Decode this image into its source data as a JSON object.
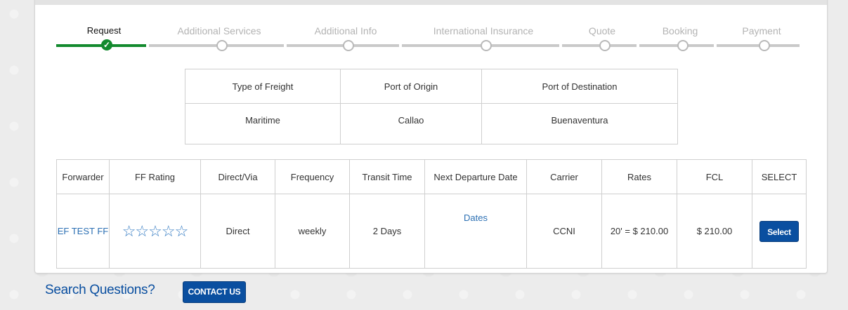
{
  "wizard": {
    "steps": [
      {
        "label": "Request",
        "state": "done"
      },
      {
        "label": "Additional Services",
        "state": "pending"
      },
      {
        "label": "Additional Info",
        "state": "pending"
      },
      {
        "label": "International Insurance",
        "state": "pending"
      },
      {
        "label": "Quote",
        "state": "pending"
      },
      {
        "label": "Booking",
        "state": "pending"
      },
      {
        "label": "Payment",
        "state": "pending"
      }
    ],
    "check_glyph": "✓"
  },
  "summary": {
    "headers": [
      "Type of Freight",
      "Port of Origin",
      "Port of Destination"
    ],
    "values": [
      "Maritime",
      "Callao",
      "Buenaventura"
    ]
  },
  "results": {
    "headers": [
      "Forwarder",
      "FF Rating",
      "Direct/Via",
      "Frequency",
      "Transit Time",
      "Next Departure Date",
      "Carrier",
      "Rates",
      "FCL",
      "SELECT"
    ],
    "row": {
      "forwarder": "EF TEST FF",
      "rating_stars": "☆☆☆☆☆",
      "direct_via": "Direct",
      "frequency": "weekly",
      "transit_time": "2 Days",
      "departure_link": "Dates",
      "carrier": "CCNI",
      "rates": "20' = $ 210.00",
      "fcl": "$ 210.00",
      "select_label": "Select"
    }
  },
  "footer": {
    "search_questions": "Search Questions?",
    "contact_label": "CONTACT US"
  },
  "colors": {
    "accent": "#0a4fa0",
    "done": "#138a2e",
    "link": "#2b6fb3"
  }
}
